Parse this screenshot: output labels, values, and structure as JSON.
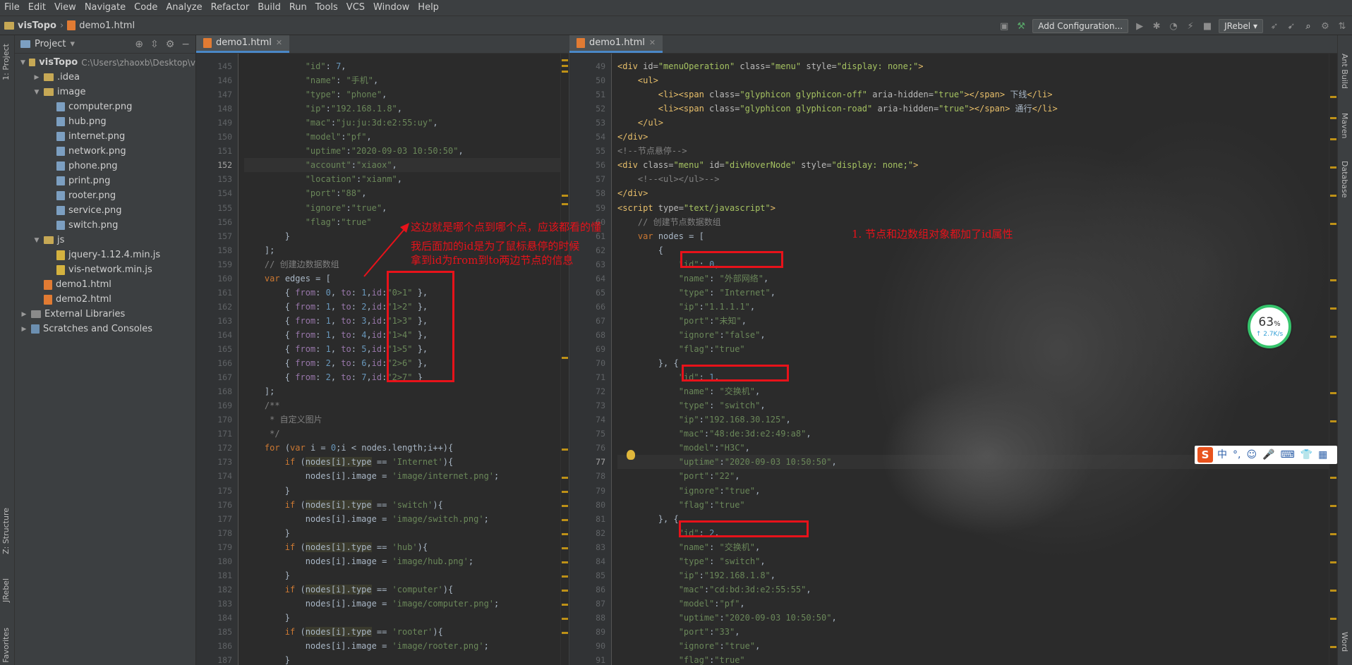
{
  "menubar": [
    "File",
    "Edit",
    "View",
    "Navigate",
    "Code",
    "Analyze",
    "Refactor",
    "Build",
    "Run",
    "Tools",
    "VCS",
    "Window",
    "Help"
  ],
  "breadcrumb": {
    "project": "visTopo",
    "file": "demo1.html"
  },
  "toolbar": {
    "add_configuration": "Add Configuration...",
    "jrebel": "JRebel"
  },
  "left_tabs": {
    "project": "1: Project",
    "structure": "Z: Structure",
    "jrebel": "JRebel",
    "favorites": "Favorites"
  },
  "right_tabs": {
    "ant": "Ant Build",
    "maven": "Maven",
    "database": "Database",
    "word": "Word"
  },
  "project_panel": {
    "title": "Project",
    "root": {
      "name": "visTopo",
      "path": "C:\\Users\\zhaoxb\\Desktop\\v"
    },
    "items": [
      {
        "label": ".idea",
        "kind": "folder",
        "indent": 1,
        "arrow": "▶"
      },
      {
        "label": "image",
        "kind": "folder",
        "indent": 1,
        "arrow": "▼"
      },
      {
        "label": "computer.png",
        "kind": "png",
        "indent": 2
      },
      {
        "label": "hub.png",
        "kind": "png",
        "indent": 2
      },
      {
        "label": "internet.png",
        "kind": "png",
        "indent": 2
      },
      {
        "label": "network.png",
        "kind": "png",
        "indent": 2
      },
      {
        "label": "phone.png",
        "kind": "png",
        "indent": 2
      },
      {
        "label": "print.png",
        "kind": "png",
        "indent": 2
      },
      {
        "label": "rooter.png",
        "kind": "png",
        "indent": 2
      },
      {
        "label": "service.png",
        "kind": "png",
        "indent": 2
      },
      {
        "label": "switch.png",
        "kind": "png",
        "indent": 2
      },
      {
        "label": "js",
        "kind": "folder",
        "indent": 1,
        "arrow": "▼"
      },
      {
        "label": "jquery-1.12.4.min.js",
        "kind": "js",
        "indent": 2
      },
      {
        "label": "vis-network.min.js",
        "kind": "js",
        "indent": 2
      },
      {
        "label": "demo1.html",
        "kind": "html",
        "indent": 1
      },
      {
        "label": "demo2.html",
        "kind": "html",
        "indent": 1
      },
      {
        "label": "External Libraries",
        "kind": "lib",
        "indent": 0,
        "arrow": "▶"
      },
      {
        "label": "Scratches and Consoles",
        "kind": "scratch",
        "indent": 0,
        "arrow": "▶"
      }
    ]
  },
  "left_editor": {
    "tab": "demo1.html",
    "current_line": "152",
    "lines": [
      {
        "n": "145",
        "h": "            <span class=\"s\">\"id\"</span><span class=\"txt\">: </span><span class=\"n\">7</span><span class=\"txt\">,</span>"
      },
      {
        "n": "146",
        "h": "            <span class=\"s\">\"name\"</span><span class=\"txt\">: </span><span class=\"s\">\"手机\"</span><span class=\"txt\">,</span>"
      },
      {
        "n": "147",
        "h": "            <span class=\"s\">\"type\"</span><span class=\"txt\">: </span><span class=\"s\">\"phone\"</span><span class=\"txt\">,</span>"
      },
      {
        "n": "148",
        "h": "            <span class=\"s\">\"ip\"</span><span class=\"txt\">:</span><span class=\"s\">\"192.168.1.8\"</span><span class=\"txt\">,</span>"
      },
      {
        "n": "149",
        "h": "            <span class=\"s\">\"mac\"</span><span class=\"txt\">:</span><span class=\"s\">\"ju:ju:3d:e2:55:uy\"</span><span class=\"txt\">,</span>"
      },
      {
        "n": "150",
        "h": "            <span class=\"s\">\"model\"</span><span class=\"txt\">:</span><span class=\"s\">\"pf\"</span><span class=\"txt\">,</span>"
      },
      {
        "n": "151",
        "h": "            <span class=\"s\">\"uptime\"</span><span class=\"txt\">:</span><span class=\"s\">\"2020-09-03 10:50:50\"</span><span class=\"txt\">,</span>"
      },
      {
        "n": "152",
        "h": "            <span class=\"s\">\"account\"</span><span class=\"txt\">:</span><span class=\"s\">\"xiaox\"</span><span class=\"txt\">,</span>"
      },
      {
        "n": "153",
        "h": "            <span class=\"s\">\"location\"</span><span class=\"txt\">:</span><span class=\"s\">\"xianm\"</span><span class=\"txt\">,</span>"
      },
      {
        "n": "154",
        "h": "            <span class=\"s\">\"port\"</span><span class=\"txt\">:</span><span class=\"s\">\"88\"</span><span class=\"txt\">,</span>"
      },
      {
        "n": "155",
        "h": "            <span class=\"s\">\"ignore\"</span><span class=\"txt\">:</span><span class=\"s\">\"true\"</span><span class=\"txt\">,</span>"
      },
      {
        "n": "156",
        "h": "            <span class=\"s\">\"flag\"</span><span class=\"txt\">:</span><span class=\"s\">\"true\"</span>"
      },
      {
        "n": "157",
        "h": "        <span class=\"txt\">}</span>"
      },
      {
        "n": "158",
        "h": "    <span class=\"txt\">];</span>"
      },
      {
        "n": "159",
        "h": "    <span class=\"c\">// 创建边数据数组</span>"
      },
      {
        "n": "160",
        "h": "    <span class=\"k\">var</span><span class=\"txt\"> edges = [</span>"
      },
      {
        "n": "161",
        "h": "        <span class=\"txt\">{ </span><span class=\"p\">from</span><span class=\"txt\">: </span><span class=\"n\">0</span><span class=\"txt\">, </span><span class=\"p\">to</span><span class=\"txt\">: </span><span class=\"n\">1</span><span class=\"txt\">,</span><span class=\"p\">id</span><span class=\"txt\">:</span><span class=\"s\">\"0>1\"</span><span class=\"txt\"> },</span>"
      },
      {
        "n": "162",
        "h": "        <span class=\"txt\">{ </span><span class=\"p\">from</span><span class=\"txt\">: </span><span class=\"n\">1</span><span class=\"txt\">, </span><span class=\"p\">to</span><span class=\"txt\">: </span><span class=\"n\">2</span><span class=\"txt\">,</span><span class=\"p\">id</span><span class=\"txt\">:</span><span class=\"s\">\"1>2\"</span><span class=\"txt\"> },</span>"
      },
      {
        "n": "163",
        "h": "        <span class=\"txt\">{ </span><span class=\"p\">from</span><span class=\"txt\">: </span><span class=\"n\">1</span><span class=\"txt\">, </span><span class=\"p\">to</span><span class=\"txt\">: </span><span class=\"n\">3</span><span class=\"txt\">,</span><span class=\"p\">id</span><span class=\"txt\">:</span><span class=\"s\">\"1>3\"</span><span class=\"txt\"> },</span>"
      },
      {
        "n": "164",
        "h": "        <span class=\"txt\">{ </span><span class=\"p\">from</span><span class=\"txt\">: </span><span class=\"n\">1</span><span class=\"txt\">, </span><span class=\"p\">to</span><span class=\"txt\">: </span><span class=\"n\">4</span><span class=\"txt\">,</span><span class=\"p\">id</span><span class=\"txt\">:</span><span class=\"s\">\"1>4\"</span><span class=\"txt\"> },</span>"
      },
      {
        "n": "165",
        "h": "        <span class=\"txt\">{ </span><span class=\"p\">from</span><span class=\"txt\">: </span><span class=\"n\">1</span><span class=\"txt\">, </span><span class=\"p\">to</span><span class=\"txt\">: </span><span class=\"n\">5</span><span class=\"txt\">,</span><span class=\"p\">id</span><span class=\"txt\">:</span><span class=\"s\">\"1>5\"</span><span class=\"txt\"> },</span>"
      },
      {
        "n": "166",
        "h": "        <span class=\"txt\">{ </span><span class=\"p\">from</span><span class=\"txt\">: </span><span class=\"n\">2</span><span class=\"txt\">, </span><span class=\"p\">to</span><span class=\"txt\">: </span><span class=\"n\">6</span><span class=\"txt\">,</span><span class=\"p\">id</span><span class=\"txt\">:</span><span class=\"s\">\"2>6\"</span><span class=\"txt\"> },</span>"
      },
      {
        "n": "167",
        "h": "        <span class=\"txt\">{ </span><span class=\"p\">from</span><span class=\"txt\">: </span><span class=\"n\">2</span><span class=\"txt\">, </span><span class=\"p\">to</span><span class=\"txt\">: </span><span class=\"n\">7</span><span class=\"txt\">,</span><span class=\"p\">id</span><span class=\"txt\">:</span><span class=\"s\">\"2>7\"</span><span class=\"txt\"> }</span>"
      },
      {
        "n": "168",
        "h": "    <span class=\"txt\">];</span>"
      },
      {
        "n": "169",
        "h": "    <span class=\"c\">/**</span>"
      },
      {
        "n": "170",
        "h": "     <span class=\"c\">* 自定义图片</span>"
      },
      {
        "n": "171",
        "h": "     <span class=\"c\">*/</span>"
      },
      {
        "n": "172",
        "h": "    <span class=\"k\">for</span><span class=\"txt\"> (</span><span class=\"k\">var</span><span class=\"txt\"> i = </span><span class=\"n\">0</span><span class=\"txt\">;i &lt; nodes.length;i++){</span>"
      },
      {
        "n": "173",
        "h": "        <span class=\"k\">if</span><span class=\"txt\"> (</span><span class=\"txt hl\">nodes[i].type</span><span class=\"txt\"> == </span><span class=\"s\">'Internet'</span><span class=\"txt\">){</span>"
      },
      {
        "n": "174",
        "h": "            <span class=\"txt\">nodes[i].image = </span><span class=\"s\">'image/internet.png'</span><span class=\"txt\">;</span>"
      },
      {
        "n": "175",
        "h": "        <span class=\"txt\">}</span>"
      },
      {
        "n": "176",
        "h": "        <span class=\"k\">if</span><span class=\"txt\"> (</span><span class=\"txt hl\">nodes[i].type</span><span class=\"txt\"> == </span><span class=\"s\">'switch'</span><span class=\"txt\">){</span>"
      },
      {
        "n": "177",
        "h": "            <span class=\"txt\">nodes[i].image = </span><span class=\"s\">'image/switch.png'</span><span class=\"txt\">;</span>"
      },
      {
        "n": "178",
        "h": "        <span class=\"txt\">}</span>"
      },
      {
        "n": "179",
        "h": "        <span class=\"k\">if</span><span class=\"txt\"> (</span><span class=\"txt hl\">nodes[i].type</span><span class=\"txt\"> == </span><span class=\"s\">'hub'</span><span class=\"txt\">){</span>"
      },
      {
        "n": "180",
        "h": "            <span class=\"txt\">nodes[i].image = </span><span class=\"s\">'image/hub.png'</span><span class=\"txt\">;</span>"
      },
      {
        "n": "181",
        "h": "        <span class=\"txt\">}</span>"
      },
      {
        "n": "182",
        "h": "        <span class=\"k\">if</span><span class=\"txt\"> (</span><span class=\"txt hl\">nodes[i].type</span><span class=\"txt\"> == </span><span class=\"s\">'computer'</span><span class=\"txt\">){</span>"
      },
      {
        "n": "183",
        "h": "            <span class=\"txt\">nodes[i].image = </span><span class=\"s\">'image/computer.png'</span><span class=\"txt\">;</span>"
      },
      {
        "n": "184",
        "h": "        <span class=\"txt\">}</span>"
      },
      {
        "n": "185",
        "h": "        <span class=\"k\">if</span><span class=\"txt\"> (</span><span class=\"txt hl\">nodes[i].type</span><span class=\"txt\"> == </span><span class=\"s\">'rooter'</span><span class=\"txt\">){</span>"
      },
      {
        "n": "186",
        "h": "            <span class=\"txt\">nodes[i].image = </span><span class=\"s\">'image/rooter.png'</span><span class=\"txt\">;</span>"
      },
      {
        "n": "187",
        "h": "        <span class=\"txt\">}</span>"
      }
    ]
  },
  "right_editor": {
    "tab": "demo1.html",
    "current_line": "77",
    "lines": [
      {
        "n": "49",
        "h": "<span class=\"t\">&lt;div </span><span class=\"a\">id=</span><span class=\"v\">\"menuOperation\"</span><span class=\"a\"> class=</span><span class=\"v\">\"menu\"</span><span class=\"a\"> style=</span><span class=\"v\">\"display: none;\"</span><span class=\"t\">&gt;</span>"
      },
      {
        "n": "50",
        "h": "    <span class=\"t\">&lt;ul&gt;</span>"
      },
      {
        "n": "51",
        "h": "        <span class=\"t\">&lt;li&gt;&lt;span </span><span class=\"a\">class=</span><span class=\"v\">\"glyphicon glyphicon-off\"</span><span class=\"a\"> aria-hidden=</span><span class=\"v\">\"true\"</span><span class=\"t\">&gt;&lt;/span&gt;</span><span class=\"txt\"> 下线</span><span class=\"t\">&lt;/li&gt;</span>"
      },
      {
        "n": "52",
        "h": "        <span class=\"t\">&lt;li&gt;&lt;span </span><span class=\"a\">class=</span><span class=\"v\">\"glyphicon glyphicon-road\"</span><span class=\"a\"> aria-hidden=</span><span class=\"v\">\"true\"</span><span class=\"t\">&gt;&lt;/span&gt;</span><span class=\"txt\"> 通行</span><span class=\"t\">&lt;/li&gt;</span>"
      },
      {
        "n": "53",
        "h": "    <span class=\"t\">&lt;/ul&gt;</span>"
      },
      {
        "n": "54",
        "h": "<span class=\"t\">&lt;/div&gt;</span>"
      },
      {
        "n": "55",
        "h": "<span class=\"c\">&lt;!--节点悬停--&gt;</span>"
      },
      {
        "n": "56",
        "h": "<span class=\"t\">&lt;div </span><span class=\"a\">class=</span><span class=\"v\">\"menu\"</span><span class=\"a\"> id=</span><span class=\"v\">\"divHoverNode\"</span><span class=\"a\"> style=</span><span class=\"v\">\"display: none;\"</span><span class=\"t\">&gt;</span>"
      },
      {
        "n": "57",
        "h": "    <span class=\"c\">&lt;!--&lt;ul&gt;&lt;/ul&gt;--&gt;</span>"
      },
      {
        "n": "58",
        "h": "<span class=\"t\">&lt;/div&gt;</span>"
      },
      {
        "n": "59",
        "h": "<span class=\"t\">&lt;script </span><span class=\"a\">type=</span><span class=\"v\">\"text/javascript\"</span><span class=\"t\">&gt;</span>"
      },
      {
        "n": "60",
        "h": "    <span class=\"c\">// 创建节点数据数组</span>"
      },
      {
        "n": "61",
        "h": "    <span class=\"k\">var</span><span class=\"txt\"> nodes = [</span>"
      },
      {
        "n": "62",
        "h": "        <span class=\"txt\">{</span>"
      },
      {
        "n": "63",
        "h": "            <span class=\"s\">\"id\"</span><span class=\"txt\">: </span><span class=\"n\">0</span><span class=\"txt\">,</span>"
      },
      {
        "n": "64",
        "h": "            <span class=\"s\">\"name\"</span><span class=\"txt\">: </span><span class=\"s\">\"外部网络\"</span><span class=\"txt\">,</span>"
      },
      {
        "n": "65",
        "h": "            <span class=\"s\">\"type\"</span><span class=\"txt\">: </span><span class=\"s\">\"Internet\"</span><span class=\"txt\">,</span>"
      },
      {
        "n": "66",
        "h": "            <span class=\"s\">\"ip\"</span><span class=\"txt\">:</span><span class=\"s\">\"1.1.1.1\"</span><span class=\"txt\">,</span>"
      },
      {
        "n": "67",
        "h": "            <span class=\"s\">\"port\"</span><span class=\"txt\">:</span><span class=\"s\">\"未知\"</span><span class=\"txt\">,</span>"
      },
      {
        "n": "68",
        "h": "            <span class=\"s\">\"ignore\"</span><span class=\"txt\">:</span><span class=\"s\">\"false\"</span><span class=\"txt\">,</span>"
      },
      {
        "n": "69",
        "h": "            <span class=\"s\">\"flag\"</span><span class=\"txt\">:</span><span class=\"s\">\"true\"</span>"
      },
      {
        "n": "70",
        "h": "        <span class=\"txt\">}, {</span>"
      },
      {
        "n": "71",
        "h": "            <span class=\"s\">\"id\"</span><span class=\"txt\">: </span><span class=\"n\">1</span><span class=\"txt\">,</span>"
      },
      {
        "n": "72",
        "h": "            <span class=\"s\">\"name\"</span><span class=\"txt\">: </span><span class=\"s\">\"交换机\"</span><span class=\"txt\">,</span>"
      },
      {
        "n": "73",
        "h": "            <span class=\"s\">\"type\"</span><span class=\"txt\">: </span><span class=\"s\">\"switch\"</span><span class=\"txt\">,</span>"
      },
      {
        "n": "74",
        "h": "            <span class=\"s\">\"ip\"</span><span class=\"txt\">:</span><span class=\"s\">\"192.168.30.125\"</span><span class=\"txt\">,</span>"
      },
      {
        "n": "75",
        "h": "            <span class=\"s\">\"mac\"</span><span class=\"txt\">:</span><span class=\"s\">\"48:de:3d:e2:49:a8\"</span><span class=\"txt\">,</span>"
      },
      {
        "n": "76",
        "h": "            <span class=\"s\">\"model\"</span><span class=\"txt\">:</span><span class=\"s\">\"H3C\"</span><span class=\"txt\">,</span>"
      },
      {
        "n": "77",
        "h": "            <span class=\"s\">\"uptime\"</span><span class=\"txt\">:</span><span class=\"s\">\"2020-09-03 10:50:50\"</span><span class=\"txt\">,</span>"
      },
      {
        "n": "78",
        "h": "            <span class=\"s\">\"port\"</span><span class=\"txt\">:</span><span class=\"s\">\"22\"</span><span class=\"txt\">,</span>"
      },
      {
        "n": "79",
        "h": "            <span class=\"s\">\"ignore\"</span><span class=\"txt\">:</span><span class=\"s\">\"true\"</span><span class=\"txt\">,</span>"
      },
      {
        "n": "80",
        "h": "            <span class=\"s\">\"flag\"</span><span class=\"txt\">:</span><span class=\"s\">\"true\"</span>"
      },
      {
        "n": "81",
        "h": "        <span class=\"txt\">}, {</span>"
      },
      {
        "n": "82",
        "h": "            <span class=\"s\">\"id\"</span><span class=\"txt\">: </span><span class=\"n\">2</span><span class=\"txt\">,</span>"
      },
      {
        "n": "83",
        "h": "            <span class=\"s\">\"name\"</span><span class=\"txt\">: </span><span class=\"s\">\"交换机\"</span><span class=\"txt\">,</span>"
      },
      {
        "n": "84",
        "h": "            <span class=\"s\">\"type\"</span><span class=\"txt\">: </span><span class=\"s\">\"switch\"</span><span class=\"txt\">,</span>"
      },
      {
        "n": "85",
        "h": "            <span class=\"s\">\"ip\"</span><span class=\"txt\">:</span><span class=\"s\">\"192.168.1.8\"</span><span class=\"txt\">,</span>"
      },
      {
        "n": "86",
        "h": "            <span class=\"s\">\"mac\"</span><span class=\"txt\">:</span><span class=\"s\">\"cd:bd:3d:e2:55:55\"</span><span class=\"txt\">,</span>"
      },
      {
        "n": "87",
        "h": "            <span class=\"s\">\"model\"</span><span class=\"txt\">:</span><span class=\"s\">\"pf\"</span><span class=\"txt\">,</span>"
      },
      {
        "n": "88",
        "h": "            <span class=\"s\">\"uptime\"</span><span class=\"txt\">:</span><span class=\"s\">\"2020-09-03 10:50:50\"</span><span class=\"txt\">,</span>"
      },
      {
        "n": "89",
        "h": "            <span class=\"s\">\"port\"</span><span class=\"txt\">:</span><span class=\"s\">\"33\"</span><span class=\"txt\">,</span>"
      },
      {
        "n": "90",
        "h": "            <span class=\"s\">\"ignore\"</span><span class=\"txt\">:</span><span class=\"s\">\"true\"</span><span class=\"txt\">,</span>"
      },
      {
        "n": "91",
        "h": "            <span class=\"s\">\"flag\"</span><span class=\"txt\">:</span><span class=\"s\">\"true\"</span>"
      }
    ]
  },
  "annotations": {
    "edges_note": [
      "这边就是哪个点到哪个点，应该都看的懂",
      "我后面加的id是为了鼠标悬停的时候",
      "拿到id为from到to两边节点的信息"
    ],
    "nodes_note": "1. 节点和边数组对象都加了id属性"
  },
  "net_widget": {
    "percent": "63",
    "percent_sign": "%",
    "speed": "↑ 2.7K/s"
  },
  "ime": {
    "logo": "S",
    "items": [
      "中",
      "°,",
      "☺",
      "🎤",
      "⌨",
      "👕",
      "▦"
    ]
  },
  "colors": {
    "annotation_red": "#e8121a",
    "accent_blue": "#4a88c7",
    "widget_green": "#36c46c"
  }
}
